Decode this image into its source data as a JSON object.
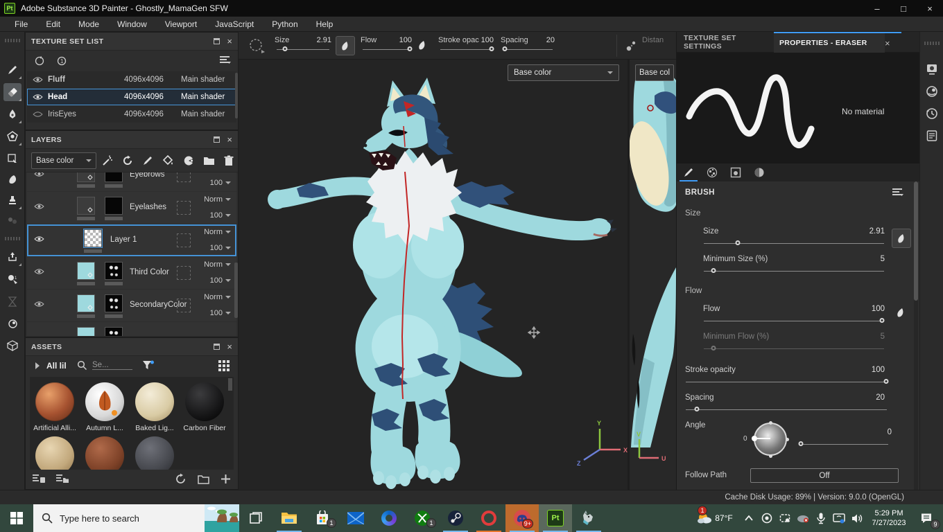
{
  "window": {
    "title": "Adobe Substance 3D Painter - Ghostly_MamaGen SFW",
    "app_badge": "Pt",
    "controls": {
      "minimize": "–",
      "maximize": "□",
      "close": "×"
    }
  },
  "menu": [
    "File",
    "Edit",
    "Mode",
    "Window",
    "Viewport",
    "JavaScript",
    "Python",
    "Help"
  ],
  "toolbar": {
    "size_label": "Size",
    "size_value": "2.91",
    "flow_label": "Flow",
    "flow_value": "100",
    "stroke_opacity_label": "Stroke opac",
    "stroke_opacity_value": "100",
    "spacing_label": "Spacing",
    "spacing_value": "20",
    "distance_label": "Distan"
  },
  "texture_set_list": {
    "title": "TEXTURE SET LIST",
    "rows": [
      {
        "name": "Fluff",
        "res": "4096x4096",
        "shader": "Main shader"
      },
      {
        "name": "Head",
        "res": "4096x4096",
        "shader": "Main shader"
      },
      {
        "name": "IrisEyes",
        "res": "4096x4096",
        "shader": "Main shader"
      }
    ]
  },
  "layers": {
    "title": "LAYERS",
    "channel": "Base color",
    "rows": [
      {
        "name": "Eyebrows",
        "blend": "",
        "opacity": "100"
      },
      {
        "name": "Eyelashes",
        "blend": "Norm",
        "opacity": "100"
      },
      {
        "name": "Layer 1",
        "blend": "Norm",
        "opacity": "100"
      },
      {
        "name": "Third Color",
        "blend": "Norm",
        "opacity": "100"
      },
      {
        "name": "SecondaryColor",
        "blend": "Norm",
        "opacity": "100"
      }
    ]
  },
  "assets": {
    "title": "ASSETS",
    "breadcrumb": "All lil",
    "search_placeholder": "Se...",
    "items": [
      "Artificial Alli...",
      "Autumn L...",
      "Baked Lig...",
      "Carbon Fiber"
    ]
  },
  "viewport": {
    "channel_3d": "Base color",
    "channel_2d": "Base col",
    "axis": {
      "x": "X",
      "y": "Y",
      "z": "Z",
      "u": "U",
      "v": "V"
    }
  },
  "properties": {
    "tab_texture_set": "TEXTURE SET SETTINGS",
    "tab_eraser": "PROPERTIES - ERASER",
    "no_material": "No material",
    "brush_section": "BRUSH",
    "size_group": "Size",
    "size_label": "Size",
    "size_value": "2.91",
    "min_size_label": "Minimum Size (%)",
    "min_size_value": "5",
    "flow_group": "Flow",
    "flow_label": "Flow",
    "flow_value": "100",
    "min_flow_label": "Minimum Flow (%)",
    "min_flow_value": "5",
    "stroke_opacity_label": "Stroke opacity",
    "stroke_opacity_value": "100",
    "spacing_label": "Spacing",
    "spacing_value": "20",
    "angle_label": "Angle",
    "angle_value": "0",
    "angle_dial_label": "0",
    "follow_path_label": "Follow Path",
    "follow_path_value": "Off"
  },
  "status": {
    "text": "Cache Disk Usage:  89% | Version: 9.0.0 (OpenGL)"
  },
  "taskbar": {
    "search_placeholder": "Type here to search",
    "weather_temp": "87°F",
    "weather_badge": "1",
    "store_badge": "1",
    "xbox_badge": "1",
    "discord_badge": "9+",
    "notification_badge": "9",
    "time": "5:29 PM",
    "date": "7/27/2023"
  },
  "colors": {
    "accent_blue": "#3f9bf5",
    "selection_blue": "#4593d6",
    "taskbar_bg": "#32473d",
    "viewport_bg": "#242424",
    "model_body": "#9ed9de",
    "model_accent": "#31517a"
  }
}
